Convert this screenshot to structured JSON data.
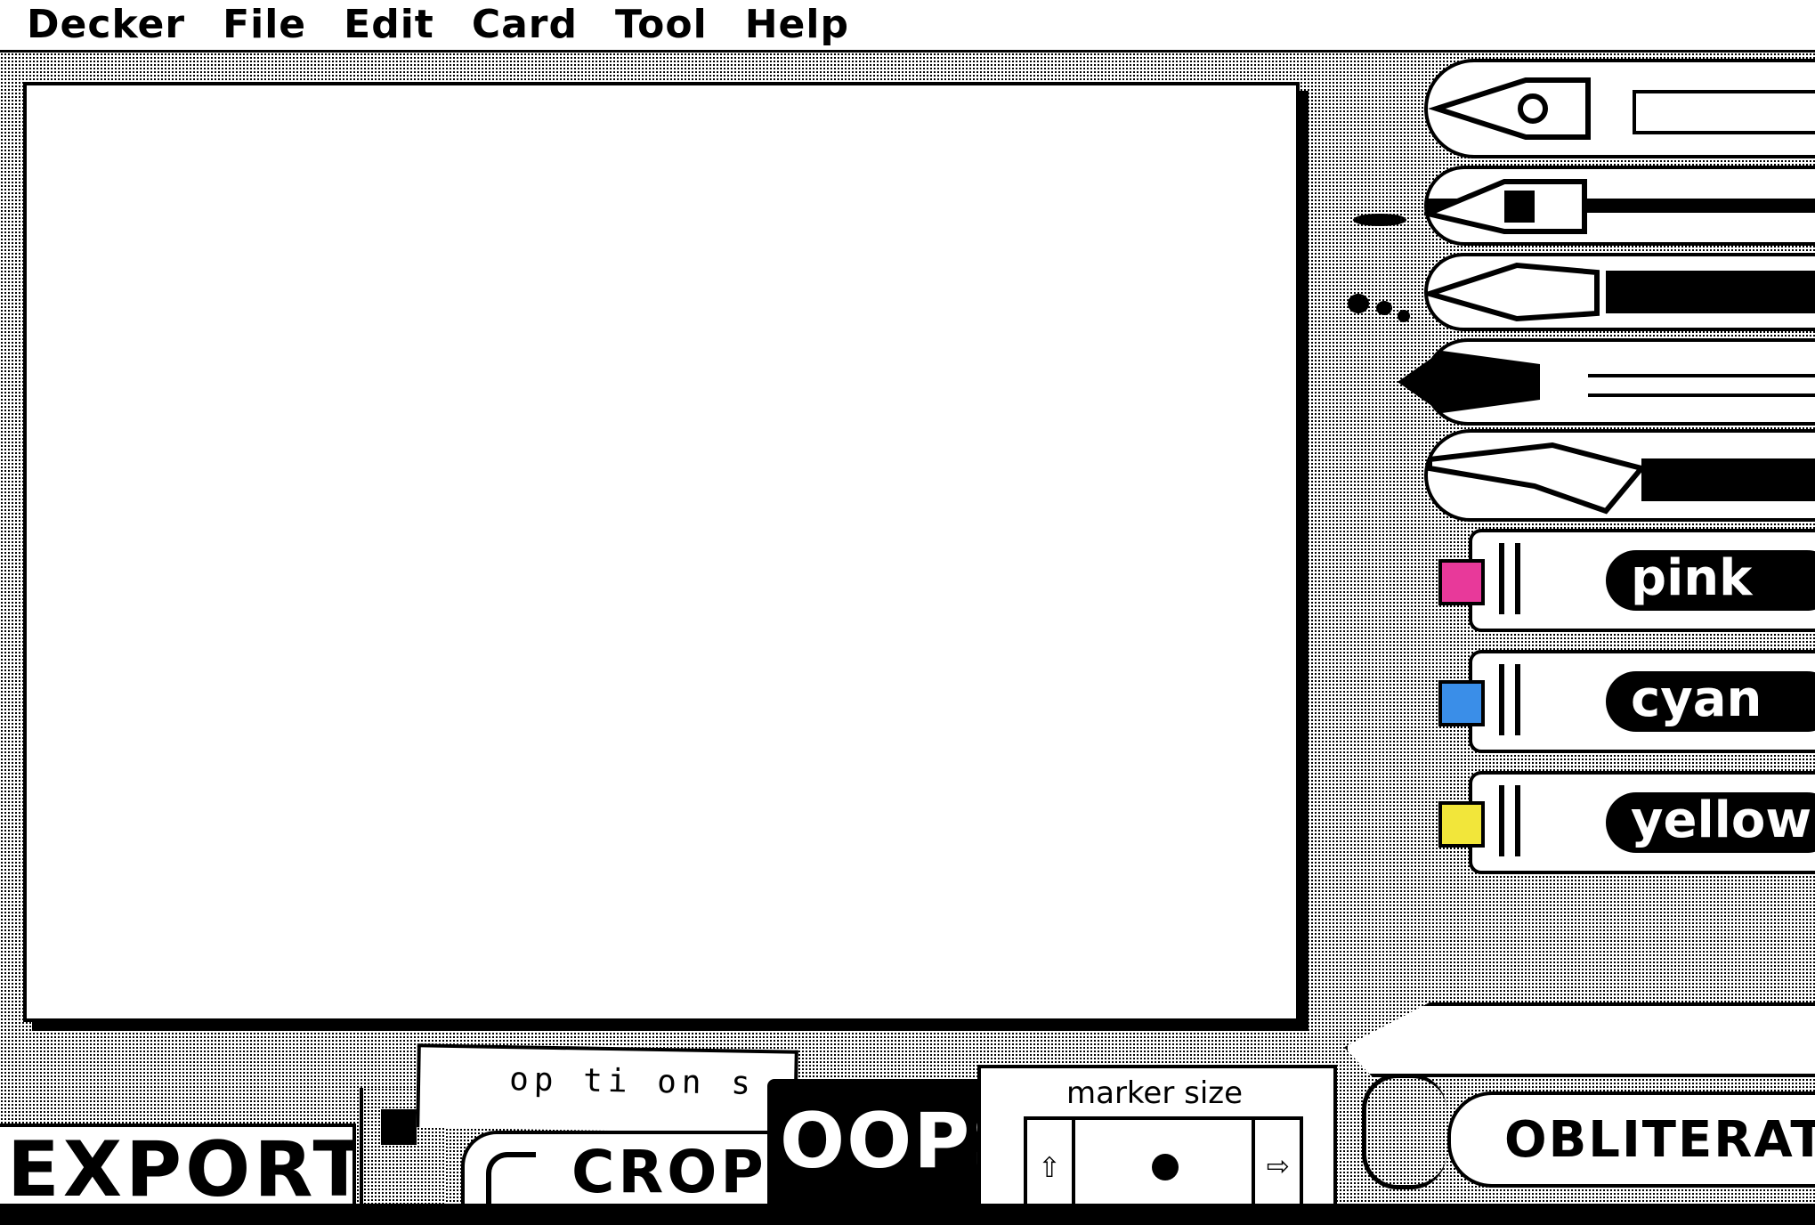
{
  "menubar": {
    "items": [
      "Decker",
      "File",
      "Edit",
      "Card",
      "Tool",
      "Help"
    ]
  },
  "markers": [
    {
      "label": "pink",
      "color": "#e8399a"
    },
    {
      "label": "cyan",
      "color": "#3a8ee8"
    },
    {
      "label": "yellow",
      "color": "#f2e63a"
    }
  ],
  "controls": {
    "export_label": "EXPORT",
    "options_label": "op ti on s",
    "crop_label": "CROP",
    "oops_label": "OOPS!",
    "marker_size_label": "marker size",
    "obliterate_label": "OBLITERATE!"
  },
  "icons": {
    "tools": [
      "fountain-pen-icon",
      "pencil-icon",
      "ink-pen-icon",
      "paintbrush-icon",
      "airbrush-icon"
    ],
    "size_prev": "arrow-left-icon",
    "size_next": "arrow-right-icon"
  }
}
